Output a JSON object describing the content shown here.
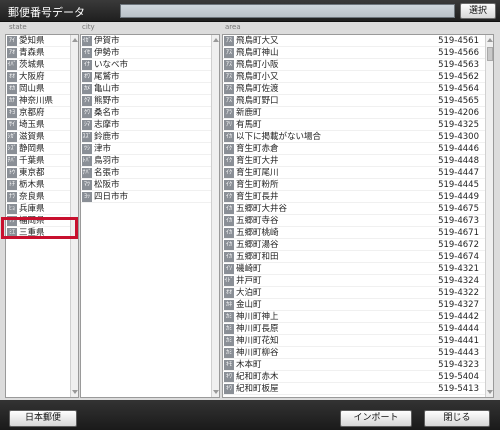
{
  "window": {
    "title": "郵便番号データ",
    "search_value": "",
    "select_label": "選択"
  },
  "columns": {
    "state_label": "state",
    "city_label": "city",
    "area_label": "area"
  },
  "states": [
    {
      "kana": "ｱｲ",
      "name": "愛知県"
    },
    {
      "kana": "ｱｵ",
      "name": "青森県"
    },
    {
      "kana": "ｲﾊﾞ",
      "name": "茨城県"
    },
    {
      "kana": "ｵｵ",
      "name": "大阪府"
    },
    {
      "kana": "ｵｶ",
      "name": "岡山県"
    },
    {
      "kana": "ｶﾅ",
      "name": "神奈川県"
    },
    {
      "kana": "ｷﾖ",
      "name": "京都府"
    },
    {
      "kana": "ｻｲ",
      "name": "埼玉県"
    },
    {
      "kana": "ｼｶﾞ",
      "name": "滋賀県"
    },
    {
      "kana": "ｼｽﾞ",
      "name": "静岡県"
    },
    {
      "kana": "ﾁﾊﾞ",
      "name": "千葉県"
    },
    {
      "kana": "ﾄｳ",
      "name": "東京都"
    },
    {
      "kana": "ﾄﾁ",
      "name": "栃木県"
    },
    {
      "kana": "ﾅﾗ",
      "name": "奈良県"
    },
    {
      "kana": "ﾋｮ",
      "name": "兵庫県"
    },
    {
      "kana": "ﾌｸ",
      "name": "福岡県"
    },
    {
      "kana": "ﾐｴ",
      "name": "三重県"
    }
  ],
  "cities": [
    {
      "kana": "ｲｶﾞ",
      "name": "伊賀市"
    },
    {
      "kana": "ｲｾ",
      "name": "伊勢市"
    },
    {
      "kana": "ｲﾅ",
      "name": "いなべ市"
    },
    {
      "kana": "ｵﾜ",
      "name": "尾鷲市"
    },
    {
      "kana": "ｶﾒ",
      "name": "亀山市"
    },
    {
      "kana": "ｸﾏ",
      "name": "熊野市"
    },
    {
      "kana": "ｸﾜ",
      "name": "桑名市"
    },
    {
      "kana": "ｼﾏ",
      "name": "志摩市"
    },
    {
      "kana": "ｽｽﾞ",
      "name": "鈴鹿市"
    },
    {
      "kana": "ﾂｼ",
      "name": "津市"
    },
    {
      "kana": "ﾄﾊﾞ",
      "name": "鳥羽市"
    },
    {
      "kana": "ﾅﾊﾞ",
      "name": "名張市"
    },
    {
      "kana": "ﾏﾂ",
      "name": "松阪市"
    },
    {
      "kana": "ﾖｯ",
      "name": "四日市市"
    }
  ],
  "areas": [
    {
      "kana": "ｱｽ",
      "name": "飛鳥町大又",
      "zip": "519-4561"
    },
    {
      "kana": "ｱｽ",
      "name": "飛鳥町神山",
      "zip": "519-4566"
    },
    {
      "kana": "ｱｽ",
      "name": "飛鳥町小阪",
      "zip": "519-4563"
    },
    {
      "kana": "ｱｽ",
      "name": "飛鳥町小又",
      "zip": "519-4562"
    },
    {
      "kana": "ｱｽ",
      "name": "飛鳥町佐渡",
      "zip": "519-4564"
    },
    {
      "kana": "ｱｽ",
      "name": "飛鳥町野口",
      "zip": "519-4565"
    },
    {
      "kana": "ｱﾗ",
      "name": "新鹿町",
      "zip": "519-4206"
    },
    {
      "kana": "ｱﾘ",
      "name": "有馬町",
      "zip": "519-4325"
    },
    {
      "kana": "ｲｶ",
      "name": "以下に掲載がない場合",
      "zip": "519-4300"
    },
    {
      "kana": "ｲｸ",
      "name": "育生町赤倉",
      "zip": "519-4446"
    },
    {
      "kana": "ｲｸ",
      "name": "育生町大井",
      "zip": "519-4448"
    },
    {
      "kana": "ｲｸ",
      "name": "育生町尾川",
      "zip": "519-4447"
    },
    {
      "kana": "ｲｸ",
      "name": "育生町粉所",
      "zip": "519-4445"
    },
    {
      "kana": "ｲｸ",
      "name": "育生町長井",
      "zip": "519-4449"
    },
    {
      "kana": "ｲｶ",
      "name": "五郷町大井谷",
      "zip": "519-4675"
    },
    {
      "kana": "ｲｶ",
      "name": "五郷町寺谷",
      "zip": "519-4673"
    },
    {
      "kana": "ｲｶ",
      "name": "五郷町桃崎",
      "zip": "519-4671"
    },
    {
      "kana": "ｲｶ",
      "name": "五郷町湯谷",
      "zip": "519-4672"
    },
    {
      "kana": "ｲｶ",
      "name": "五郷町和田",
      "zip": "519-4674"
    },
    {
      "kana": "ｲｿ",
      "name": "磯崎町",
      "zip": "519-4321"
    },
    {
      "kana": "ｲﾄﾞ",
      "name": "井戸町",
      "zip": "519-4324"
    },
    {
      "kana": "ｵｵ",
      "name": "大泊町",
      "zip": "519-4322"
    },
    {
      "kana": "ｶﾈ",
      "name": "金山町",
      "zip": "519-4327"
    },
    {
      "kana": "ｶﾐ",
      "name": "神川町神上",
      "zip": "519-4442"
    },
    {
      "kana": "ｶﾐ",
      "name": "神川町長原",
      "zip": "519-4444"
    },
    {
      "kana": "ｶﾐ",
      "name": "神川町花知",
      "zip": "519-4441"
    },
    {
      "kana": "ｶﾐ",
      "name": "神川町柳谷",
      "zip": "519-4443"
    },
    {
      "kana": "ｷﾓ",
      "name": "木本町",
      "zip": "519-4323"
    },
    {
      "kana": "ｷﾜ",
      "name": "紀和町赤木",
      "zip": "519-5404"
    },
    {
      "kana": "ｷﾜ",
      "name": "紀和町板屋",
      "zip": "519-5413"
    }
  ],
  "footer": {
    "left_button": "日本郵便",
    "import_button": "インポート",
    "close_button": "閉じる"
  },
  "colors": {
    "highlight": "#c8102e"
  }
}
